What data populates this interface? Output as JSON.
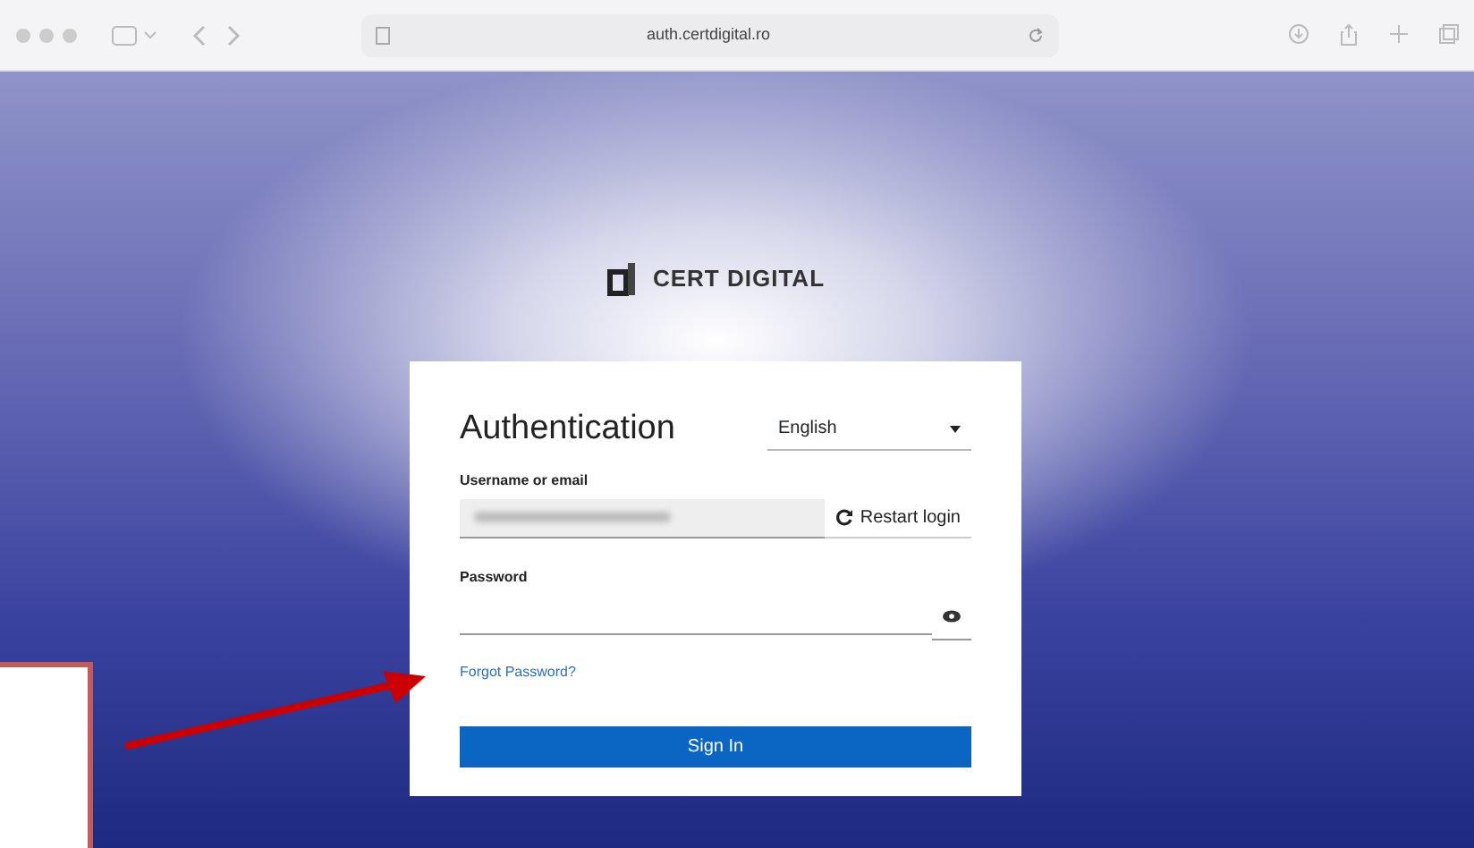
{
  "browser": {
    "address": "auth.certdigital.ro"
  },
  "logo": {
    "text": "CERT DIGITAL"
  },
  "login": {
    "title": "Authentication",
    "language": "English",
    "username_label": "Username or email",
    "restart_button": "Restart login",
    "password_label": "Password",
    "forgot_link": "Forgot Password?",
    "submit_button": "Sign In"
  }
}
